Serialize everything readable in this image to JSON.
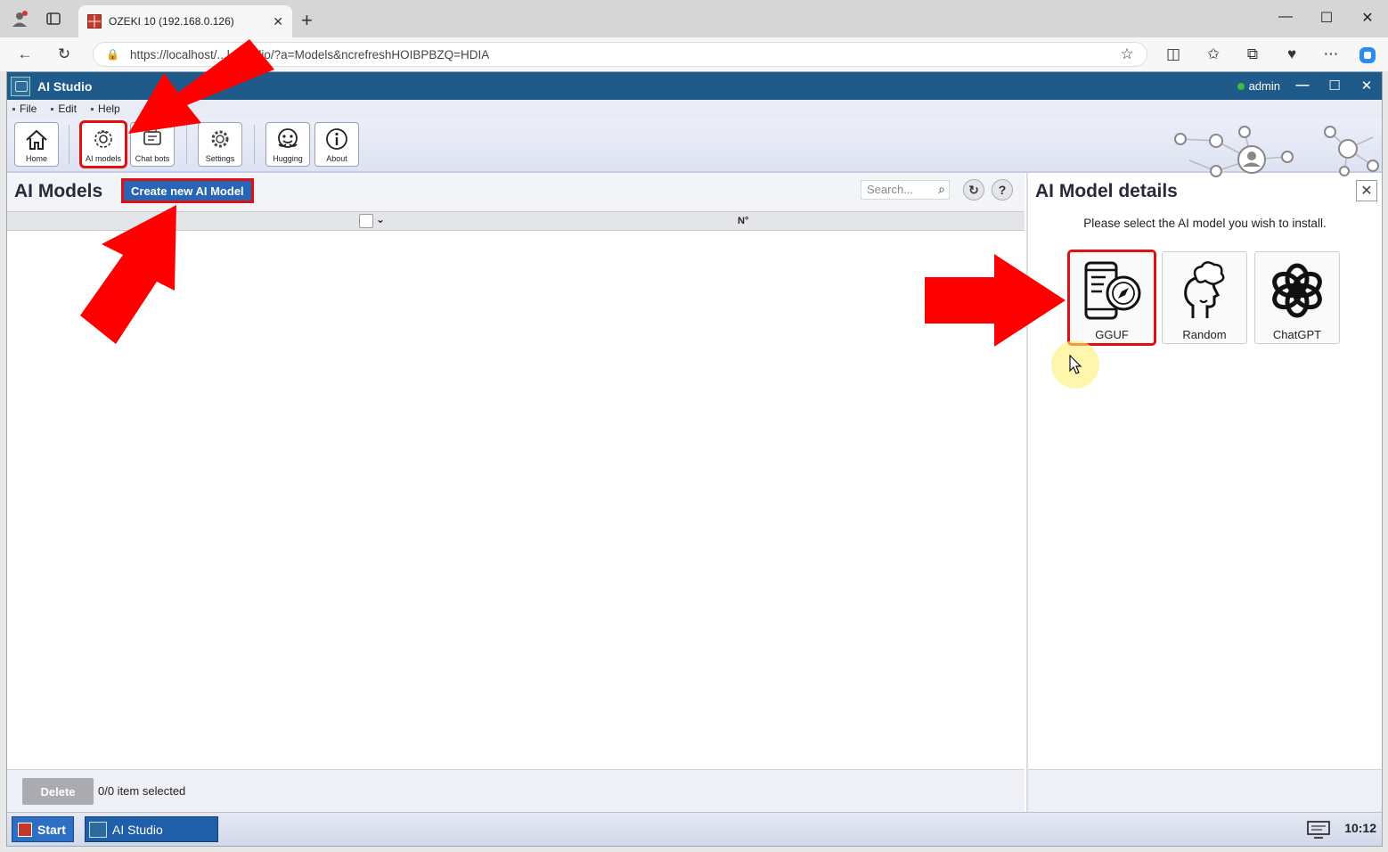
{
  "browser": {
    "tab_title": "OZEKI 10 (192.168.0.126)",
    "url": "https://localhost/...l+Studio/?a=Models&ncrefreshHOIBPBZQ=HDIA"
  },
  "app": {
    "title": "AI Studio",
    "user": "admin",
    "menu": [
      "File",
      "Edit",
      "Help"
    ],
    "toolbar": {
      "home": "Home",
      "ai_models": "AI models",
      "chat_bots": "Chat bots",
      "settings": "Settings",
      "hugging": "Hugging",
      "about": "About"
    }
  },
  "left": {
    "title": "AI Models",
    "create_button": "Create new AI Model",
    "search_placeholder": "Search...",
    "column_no": "N°",
    "delete_button": "Delete",
    "selected_count": "0/0 item selected"
  },
  "right": {
    "title": "AI Model details",
    "instruction": "Please select the AI model you wish to install.",
    "models": [
      "GGUF",
      "Random",
      "ChatGPT"
    ]
  },
  "taskbar": {
    "start": "Start",
    "app": "AI Studio",
    "clock": "10:12"
  },
  "colors": {
    "titlebar": "#1e5a8a",
    "create_button": "#2665b8",
    "highlight": "#e01010",
    "annotation_arrow": "#ff0000"
  }
}
